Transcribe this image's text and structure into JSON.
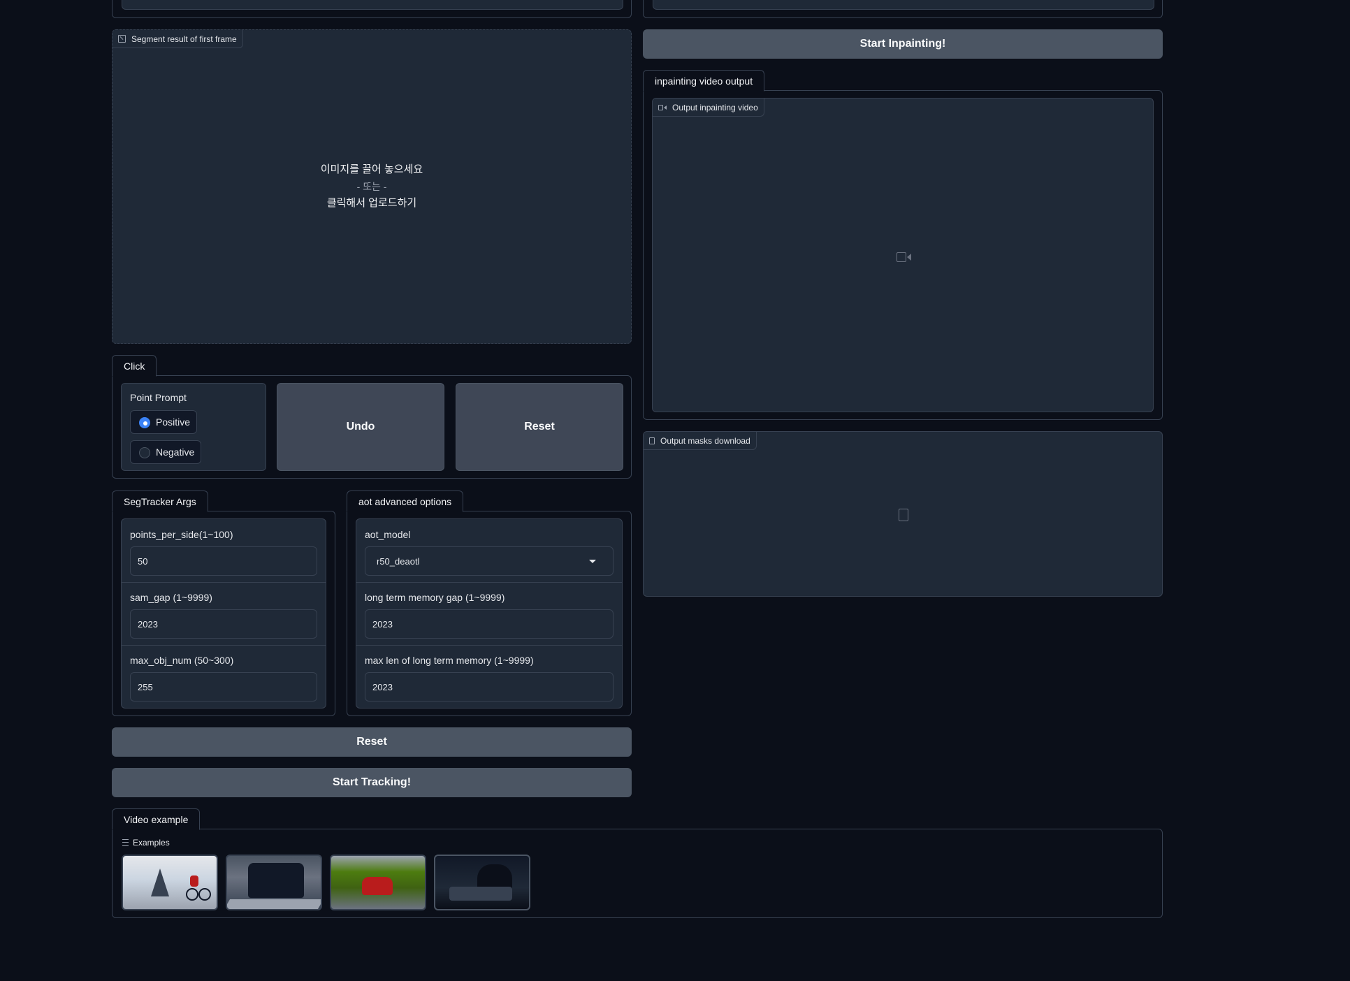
{
  "left_top_stub": {},
  "segment_result": {
    "label": "Segment result of first frame",
    "drop_line1": "이미지를 끌어 놓으세요",
    "drop_or": "- 또는 -",
    "drop_line2": "클릭해서 업로드하기"
  },
  "click_tab": {
    "label": "Click",
    "point_prompt_label": "Point Prompt",
    "options": [
      {
        "label": "Positive",
        "selected": true
      },
      {
        "label": "Negative",
        "selected": false
      }
    ],
    "undo_label": "Undo",
    "reset_label": "Reset"
  },
  "segtracker_args": {
    "tab_label": "SegTracker Args",
    "fields": [
      {
        "label": "points_per_side(1~100)",
        "value": "50"
      },
      {
        "label": "sam_gap (1~9999)",
        "value": "2023"
      },
      {
        "label": "max_obj_num (50~300)",
        "value": "255"
      }
    ]
  },
  "aot_options": {
    "tab_label": "aot advanced options",
    "model_label": "aot_model",
    "model_value": "r50_deaotl",
    "fields": [
      {
        "label": "long term memory gap (1~9999)",
        "value": "2023"
      },
      {
        "label": "max len of long term memory (1~9999)",
        "value": "2023"
      }
    ]
  },
  "actions": {
    "reset_label": "Reset",
    "start_tracking_label": "Start Tracking!",
    "start_inpainting_label": "Start Inpainting!"
  },
  "inpainting_output": {
    "tab_label": "inpainting video output",
    "video_label": "Output inpainting video"
  },
  "masks_download": {
    "label": "Output masks download"
  },
  "video_example": {
    "tab_label": "Video example",
    "examples_label": "Examples",
    "thumbnails": [
      "cyclist-in-fog",
      "black-van-on-road",
      "red-car-on-road",
      "rider-with-helmet"
    ]
  },
  "colors": {
    "background": "#0b0f19",
    "panel": "#1f2937",
    "border": "#374151",
    "button": "#4b5563",
    "accent": "#3b82f6"
  }
}
